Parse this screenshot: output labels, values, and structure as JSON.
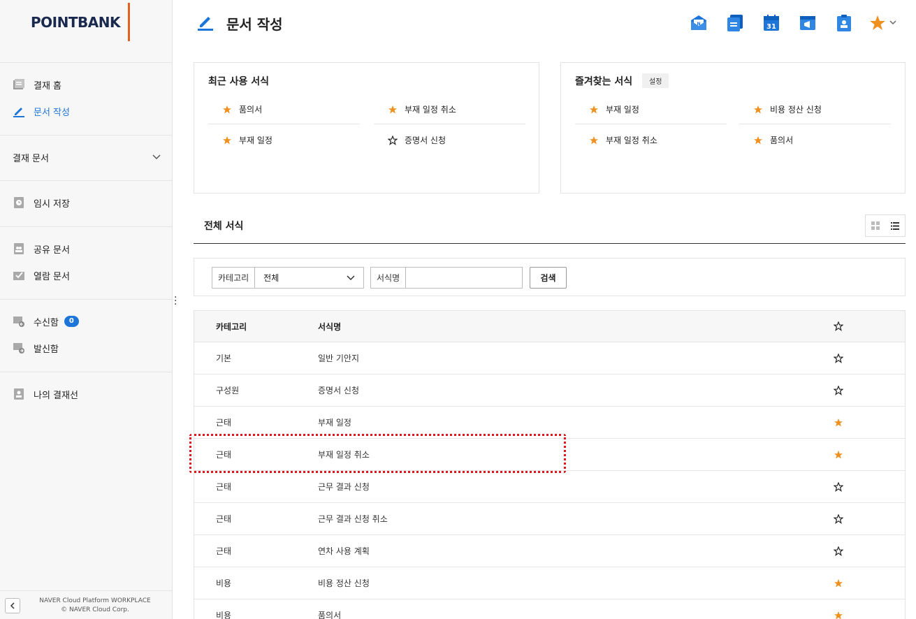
{
  "brand": {
    "logo_text": "POINTBANK",
    "accent": "#e2621b",
    "primary": "#1d74d9",
    "star": "#f0901e"
  },
  "sidebar": {
    "items": [
      {
        "label": "결재 홈",
        "icon": "approval-home-icon"
      },
      {
        "label": "문서 작성",
        "icon": "pencil-icon",
        "active": true
      },
      {
        "label": "결재 문서",
        "icon": "chevron-down-icon"
      },
      {
        "label": "임시 저장",
        "icon": "clock-doc-icon"
      },
      {
        "label": "공유 문서",
        "icon": "shared-doc-icon"
      },
      {
        "label": "열람 문서",
        "icon": "view-doc-icon"
      },
      {
        "label": "수신함",
        "icon": "inbox-icon",
        "badge": "0"
      },
      {
        "label": "발신함",
        "icon": "outbox-icon"
      },
      {
        "label": "나의 결재선",
        "icon": "my-line-icon"
      }
    ],
    "footer_line1": "NAVER Cloud Platform WORKPLACE",
    "footer_line2": "© NAVER Cloud Corp."
  },
  "header": {
    "title": "문서 작성",
    "quick_icons": [
      "mail-icon",
      "docs-icon",
      "calendar-icon",
      "notice-icon",
      "clipboard-icon",
      "star-icon"
    ],
    "calendar_day": "31"
  },
  "recent": {
    "title": "최근 사용 서식",
    "items": [
      {
        "label": "품의서",
        "starred": true
      },
      {
        "label": "부재 일정 취소",
        "starred": true
      },
      {
        "label": "부재 일정",
        "starred": true
      },
      {
        "label": "증명서 신청",
        "starred": false
      }
    ]
  },
  "favorites": {
    "title": "즐겨찾는 서식",
    "setting_label": "설정",
    "items": [
      {
        "label": "부재 일정"
      },
      {
        "label": "비용 정산 신청"
      },
      {
        "label": "부재 일정 취소"
      },
      {
        "label": "품의서"
      }
    ]
  },
  "all_forms": {
    "title": "전체 서식",
    "search": {
      "category_label": "카테고리",
      "category_value": "전체",
      "name_label": "서식명",
      "name_value": "",
      "button": "검색"
    },
    "columns": [
      "카테고리",
      "서식명"
    ],
    "rows": [
      {
        "category": "기본",
        "name": "일반 기안지",
        "starred": false
      },
      {
        "category": "구성원",
        "name": "증명서 신청",
        "starred": false
      },
      {
        "category": "근태",
        "name": "부재 일정",
        "starred": true
      },
      {
        "category": "근태",
        "name": "부재 일정 취소",
        "starred": true
      },
      {
        "category": "근태",
        "name": "근무 결과 신청",
        "starred": false
      },
      {
        "category": "근태",
        "name": "근무 결과 신청 취소",
        "starred": false
      },
      {
        "category": "근태",
        "name": "연차 사용 계획",
        "starred": false
      },
      {
        "category": "비용",
        "name": "비용 정산 신청",
        "starred": true
      },
      {
        "category": "비용",
        "name": "품의서",
        "starred": true
      }
    ]
  }
}
